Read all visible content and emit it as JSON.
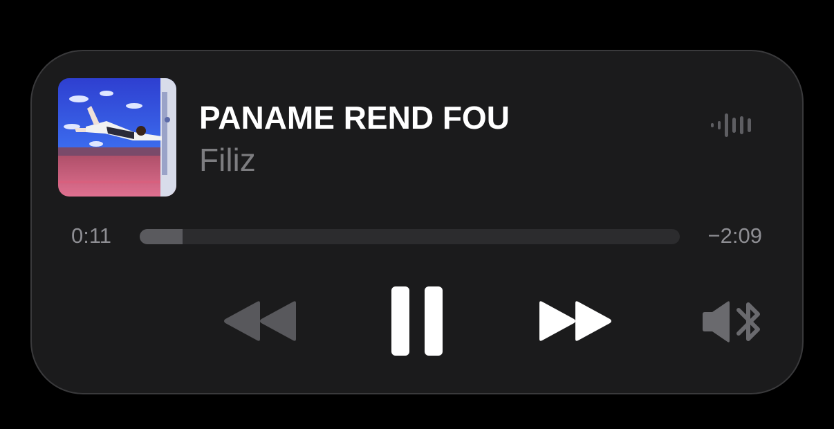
{
  "now_playing": {
    "title": "PANAME REND FOU",
    "artist": "Filiz",
    "artwork": "album-artwork"
  },
  "playback": {
    "elapsed": "0:11",
    "remaining": "−2:09",
    "progress_fraction": 0.08,
    "state": "playing"
  },
  "icons": {
    "waveform": "waveform-icon",
    "rewind": "rewind-icon",
    "pause": "pause-icon",
    "forward": "fast-forward-icon",
    "audio_output": "speaker-bluetooth-icon"
  },
  "colors": {
    "card_background": "#1b1b1c",
    "title": "#ffffff",
    "secondary_text": "#8e8e93",
    "track": "#2c2c2e",
    "fill": "#5a5a5e",
    "disabled_control": "#58585c"
  }
}
